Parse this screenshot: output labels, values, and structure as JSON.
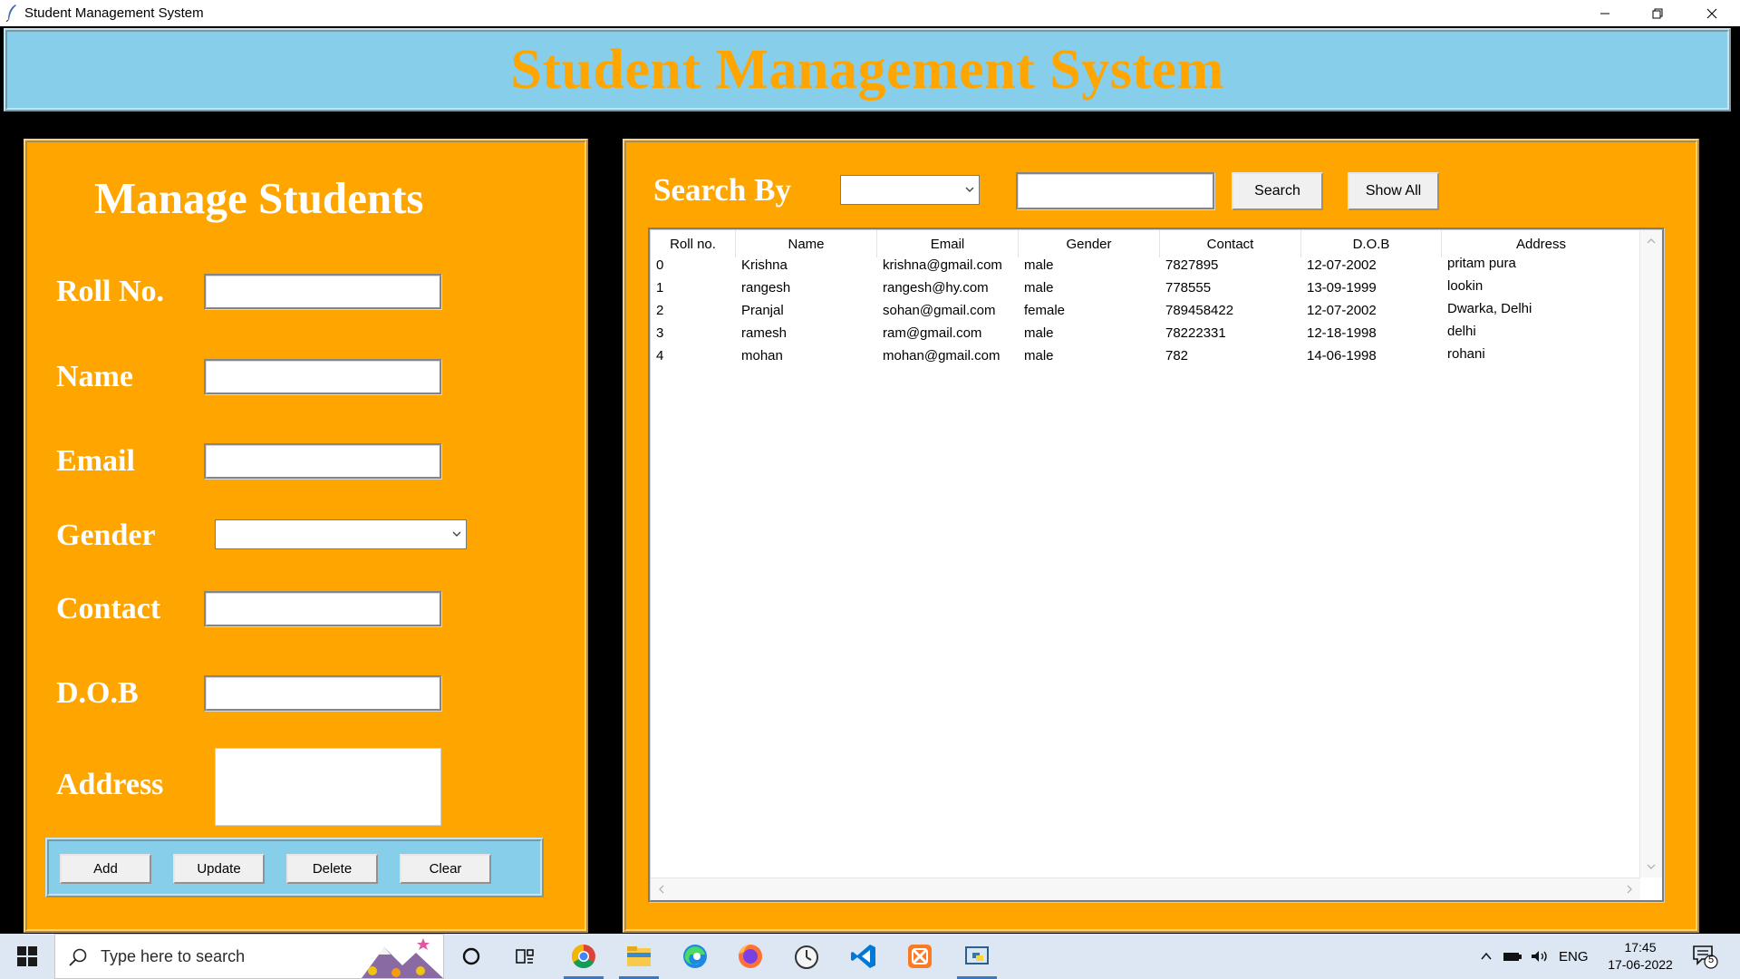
{
  "window": {
    "title": "Student Management System"
  },
  "header": {
    "title": "Student Management System"
  },
  "manage": {
    "title": "Manage Students",
    "fields": {
      "roll": {
        "label": "Roll No.",
        "value": ""
      },
      "name": {
        "label": "Name",
        "value": ""
      },
      "email": {
        "label": "Email",
        "value": ""
      },
      "gender": {
        "label": "Gender",
        "value": ""
      },
      "contact": {
        "label": "Contact",
        "value": ""
      },
      "dob": {
        "label": "D.O.B",
        "value": ""
      },
      "address": {
        "label": "Address",
        "value": ""
      }
    },
    "buttons": {
      "add": "Add",
      "update": "Update",
      "delete": "Delete",
      "clear": "Clear"
    }
  },
  "search": {
    "label": "Search By",
    "by_value": "",
    "text_value": "",
    "search_button": "Search",
    "show_all_button": "Show All"
  },
  "table": {
    "columns": [
      "Roll no.",
      "Name",
      "Email",
      "Gender",
      "Contact",
      "D.O.B",
      "Address"
    ],
    "rows": [
      [
        "0",
        "Krishna",
        "krishna@gmail.com",
        "male",
        "7827895",
        "12-07-2002",
        "pritam pura"
      ],
      [
        "1",
        "rangesh",
        "rangesh@hy.com",
        "male",
        "778555",
        "13-09-1999",
        "lookin"
      ],
      [
        "2",
        "Pranjal",
        "sohan@gmail.com",
        "female",
        "789458422",
        "12-07-2002",
        "Dwarka, Delhi"
      ],
      [
        "3",
        "ramesh",
        "ram@gmail.com",
        "male",
        "78222331",
        "12-18-1998",
        "delhi"
      ],
      [
        "4",
        "mohan",
        "mohan@gmail.com",
        "male",
        "782",
        "14-06-1998",
        "rohani"
      ]
    ]
  },
  "taskbar": {
    "search_placeholder": "Type here to search",
    "apps": [
      "cortana-icon",
      "task-view-icon",
      "chrome-icon",
      "file-explorer-icon",
      "edge-icon",
      "firefox-icon",
      "clock-app-icon",
      "vscode-icon",
      "xampp-icon",
      "python-idle-icon"
    ],
    "language": "ENG",
    "time": "17:45",
    "date": "17-06-2022",
    "notification_count": "5"
  },
  "colors": {
    "panel": "#ffa500",
    "banner": "#87ceeb",
    "title_text": "#ffa500",
    "label_text": "#ffffff"
  }
}
